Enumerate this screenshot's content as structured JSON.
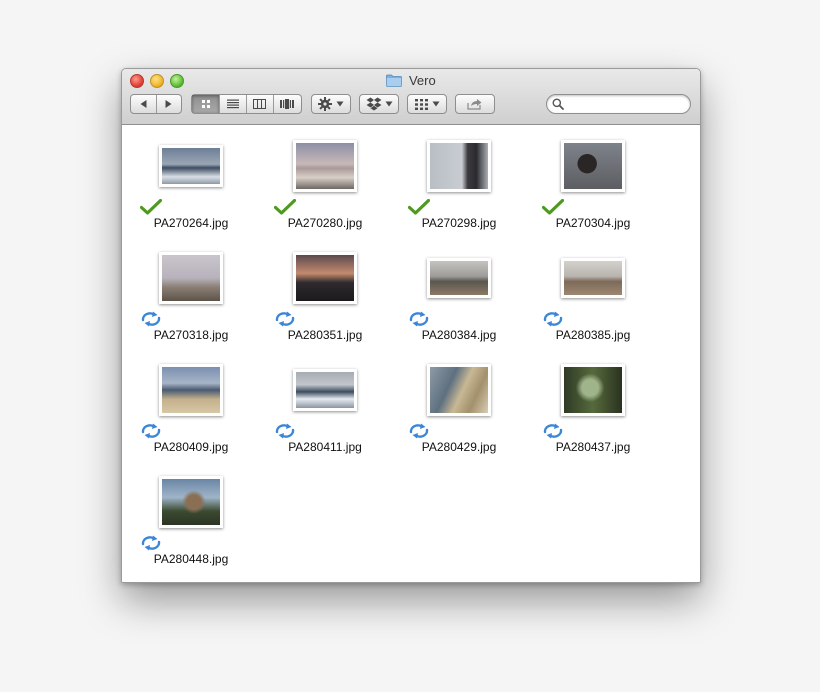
{
  "window": {
    "title": "Vero"
  },
  "toolbar": {
    "back_icon": "back-arrow-icon",
    "forward_icon": "forward-arrow-icon",
    "views": [
      "icon-view-icon",
      "list-view-icon",
      "column-view-icon",
      "coverflow-view-icon"
    ],
    "active_view": "icon-view",
    "action_icon": "gear-icon",
    "dropbox_icon": "dropbox-icon",
    "arrange_icon": "arrange-icon",
    "share_icon": "share-icon"
  },
  "search": {
    "value": "",
    "placeholder": ""
  },
  "files": [
    {
      "name": "PA270264.jpg",
      "status": "synced"
    },
    {
      "name": "PA270280.jpg",
      "status": "synced"
    },
    {
      "name": "PA270298.jpg",
      "status": "synced"
    },
    {
      "name": "PA270304.jpg",
      "status": "synced"
    },
    {
      "name": "PA270318.jpg",
      "status": "syncing"
    },
    {
      "name": "PA280351.jpg",
      "status": "syncing"
    },
    {
      "name": "PA280384.jpg",
      "status": "syncing"
    },
    {
      "name": "PA280385.jpg",
      "status": "syncing"
    },
    {
      "name": "PA280409.jpg",
      "status": "syncing"
    },
    {
      "name": "PA280411.jpg",
      "status": "syncing"
    },
    {
      "name": "PA280429.jpg",
      "status": "syncing"
    },
    {
      "name": "PA280437.jpg",
      "status": "syncing"
    },
    {
      "name": "PA280448.jpg",
      "status": "syncing"
    }
  ],
  "colors": {
    "synced": "#4e9a1e",
    "syncing": "#3b86d8",
    "window_bg": "#ffffff"
  }
}
